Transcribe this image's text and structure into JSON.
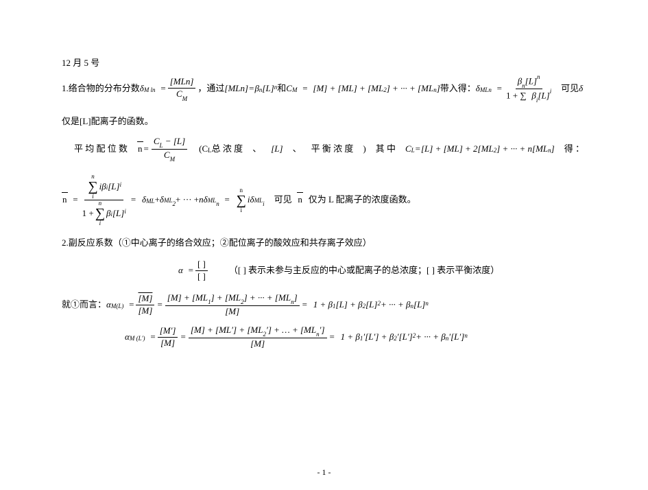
{
  "date_line": "12 月 5 号",
  "line1": {
    "prefix": "1.络合物的分布分数",
    "delta_sym": "δ",
    "delta_sub": "M ln",
    "eq": "=",
    "frac1_num": "[MLn]",
    "frac1_den_a": "C",
    "frac1_den_sub": "M",
    "mid1": "，通过",
    "mln": "[MLn]",
    "eq2": "=",
    "beta": "β",
    "beta_sub": "n",
    "L": "[L]",
    "L_sup": "n",
    "and": "和",
    "CM_a": "C",
    "CM_sub": "M",
    "eq3": "=",
    "sum_terms": "[M] + [ML] + [ML",
    "sum_sub2": "2",
    "sum_mid": "] + ··· + [ML",
    "sum_subn": "n",
    "sum_end": "]",
    "mid2": " 带入得：",
    "delta2_sym": "δ",
    "delta2_sub": "MLn",
    "eq4": "=",
    "frac2_num_a": "β",
    "frac2_num_sub": "n",
    "frac2_num_b": "[L]",
    "frac2_num_sup": "n",
    "frac2_den_a": "1 + ",
    "frac2_den_sum": "∑",
    "frac2_den_b": "β",
    "frac2_den_bsub": "i",
    "frac2_den_c": "[L]",
    "frac2_den_csup": "i",
    "tail": "可见",
    "tail_delta": "δ"
  },
  "line2": "仅是[L]配离子的函数。",
  "navg": {
    "label": "平 均 配 位 数",
    "nbar": "n",
    "eq": "=",
    "num_a": "C",
    "num_asub": "L",
    "num_minus": " − [L]",
    "den_a": "C",
    "den_asub": "M",
    "note_open": "(C",
    "note_sub": "L",
    "note_a": " 总 浓 度",
    "note_sep1": "、",
    "note_b": "[L]",
    "note_sep2": "、",
    "note_c": "平 衡 浓 度",
    "note_close": ")",
    "where": "其 中",
    "CL": "C",
    "CL_sub": "L",
    "eq2": "=",
    "expand": "[L] + [ML] + 2[ML",
    "expand_sub2": "2",
    "expand_mid": "] + ··· + n[ML",
    "expand_subn": "n",
    "expand_end": "]",
    "end": "得 ："
  },
  "nexpand": {
    "nbar": "n",
    "eq": "=",
    "sum_top": "n",
    "sum_bot": "i",
    "num_term_a": "iβ",
    "num_term_asub": "i",
    "num_term_b": "[L]",
    "num_term_bsup": "i",
    "den_a": "1 + ",
    "den_b": "β",
    "den_bsub": "i",
    "den_c": "[L]",
    "den_csup": "i",
    "eq2": "=",
    "d1": "δ",
    "d1s": "ML",
    "plus": " + ",
    "d2": "δ",
    "d2s": "ML",
    "d2s2": "2",
    "dots": " + ··· + ",
    "dn_coef": "n",
    "dn": "δ",
    "dns": "ML",
    "dns2": "n",
    "eq3": "=",
    "sum2_top": "n",
    "sum2_bot": "i",
    "term2_a": "iδ",
    "term2_as": "ML",
    "term2_as2": "i",
    "tail_a": "可见",
    "tail_n": "n",
    "tail_b": "仅为 L 配离子的浓度函数。"
  },
  "sec2_heading": "2.副反应系数（①中心离子的络合效应；②配位离子的酸效应和共存离子效应）",
  "alpha_def": {
    "alpha": "α",
    "eq": "=",
    "num": "[ ]",
    "den": "[ ]",
    "note": "（[ ] 表示未参与主反应的中心或配离子的总浓度；[ ] 表示平衡浓度）"
  },
  "case1_lead": "就①而言：",
  "alpha_ML": {
    "a": "α",
    "asub": "M(L)",
    "eq": "=",
    "f1_num": "[M]",
    "f1_den": "[M]",
    "eq2": "=",
    "f2_num_a": "[M] + [ML",
    "f2_num_s1": "1",
    "f2_num_b": "] + [ML",
    "f2_num_s2": "2",
    "f2_num_c": "] + ··· + [ML",
    "f2_num_sn": "n",
    "f2_num_d": "]",
    "f2_den": "[M]",
    "eq3": "=",
    "rhs_a": "1 + β",
    "rhs_s1": "1",
    "rhs_b": "[L] + β",
    "rhs_s2": "2",
    "rhs_c": "[L]",
    "rhs_p2": "2",
    "rhs_d": " + ··· + β",
    "rhs_sn": "n",
    "rhs_e": "[L]",
    "rhs_pn": "n"
  },
  "alpha_MLp": {
    "a": "α",
    "asub": "M (L′)",
    "eq": "=",
    "f1_num": "[M′]",
    "f1_den": "[M]",
    "eq2": "=",
    "f2_num_a": "[M] + [ML′] + [ML",
    "f2_num_s2": "2",
    "f2_num_b": "′] + … + [ML",
    "f2_num_sn": "n",
    "f2_num_c": "′]",
    "f2_den": "[M]",
    "eq3": "=",
    "rhs_a": "1 + β",
    "rhs_s1": "1",
    "rhs_ap": "′",
    "rhs_b": "[L′] + β",
    "rhs_s2": "2",
    "rhs_bp": "′",
    "rhs_c": "[L′]",
    "rhs_p2": "2",
    "rhs_d": " + ··· + β",
    "rhs_sn": "n",
    "rhs_dp": "′",
    "rhs_e": "[L′]",
    "rhs_pn": "n"
  },
  "page_number": "- 1 -"
}
